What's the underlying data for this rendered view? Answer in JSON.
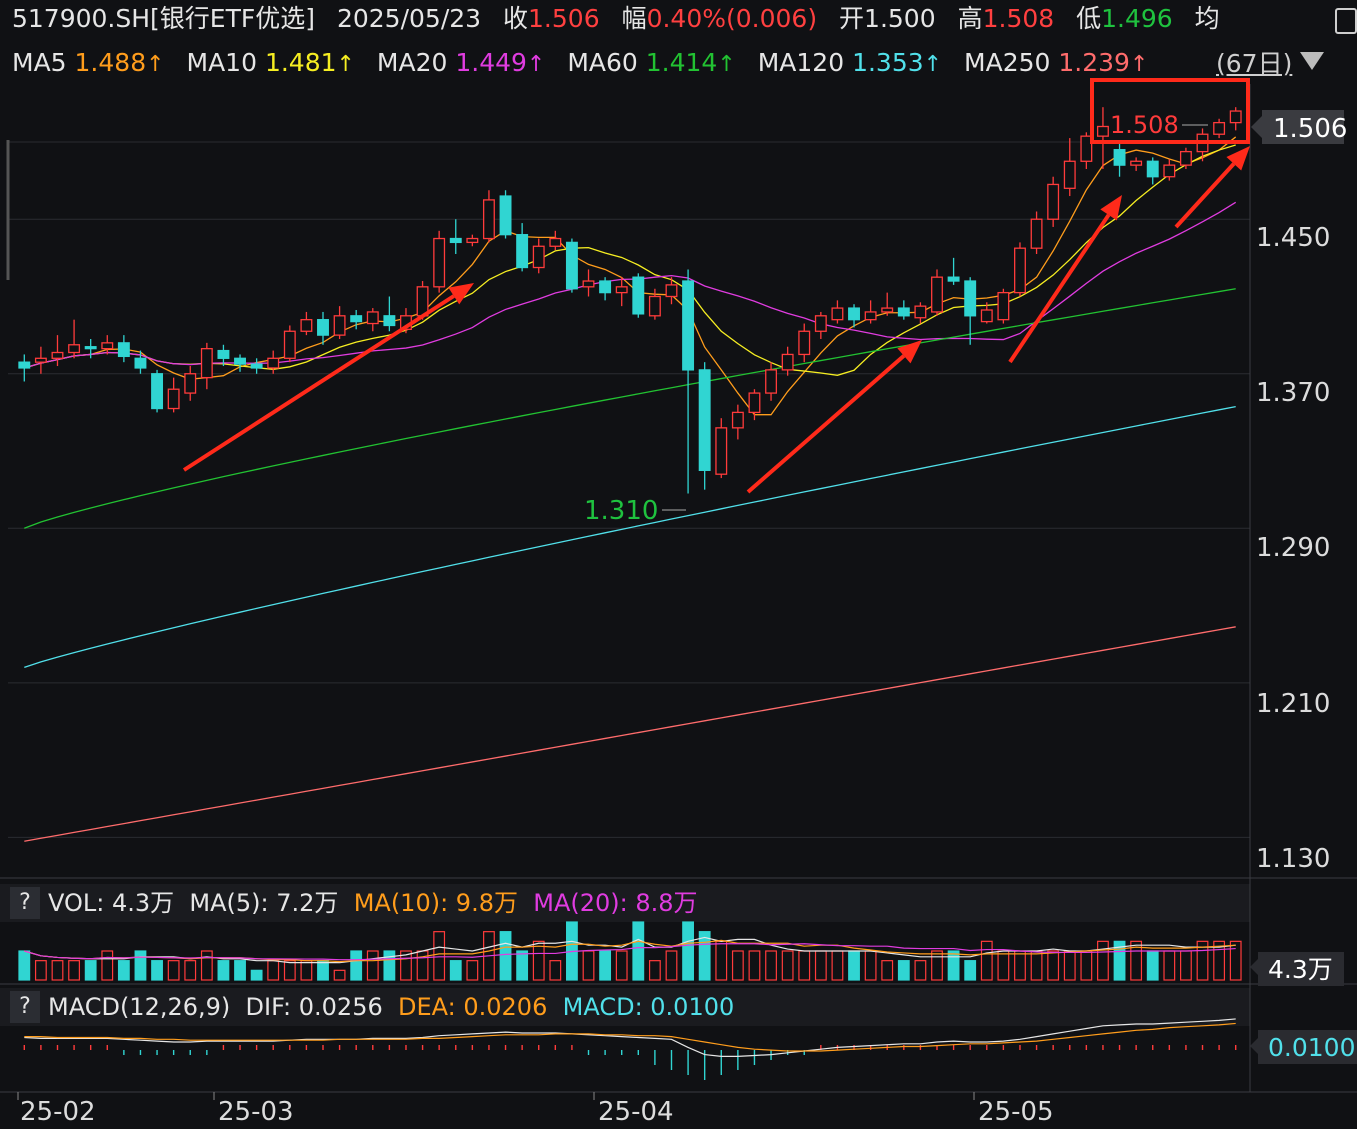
{
  "header": {
    "symbol": "517900.SH[银行ETF优选]",
    "date": "2025/05/23",
    "close_label": "收",
    "close_value": "1.506",
    "change_label": "幅",
    "change_value": "0.40%(0.006)",
    "open_label": "开",
    "open_value": "1.500",
    "high_label": "高",
    "high_value": "1.508",
    "low_label": "低",
    "low_value": "1.496",
    "avg_label": "均"
  },
  "ma_row": {
    "items": [
      {
        "label": "MA5",
        "value": "1.488",
        "arrow": "↑",
        "color": "#ff9d1c"
      },
      {
        "label": "MA10",
        "value": "1.481",
        "arrow": "↑",
        "color": "#f6ee22"
      },
      {
        "label": "MA20",
        "value": "1.449",
        "arrow": "↑",
        "color": "#e03ce0"
      },
      {
        "label": "MA60",
        "value": "1.414",
        "arrow": "↑",
        "color": "#22c232"
      },
      {
        "label": "MA120",
        "value": "1.353",
        "arrow": "↑",
        "color": "#51e0ea"
      },
      {
        "label": "MA250",
        "value": "1.239",
        "arrow": "↑",
        "color": "#ff6c6c"
      }
    ],
    "period": "(67日)"
  },
  "price_axis": {
    "ticks": [
      "1.450",
      "1.370",
      "1.290",
      "1.210",
      "1.130"
    ],
    "current_tag": "1.506"
  },
  "annotations": {
    "high_marker": "1.508",
    "low_marker": "1.310"
  },
  "volume_panel": {
    "help": "?",
    "vol_label": "VOL: 4.3万",
    "ma5_label": "MA(5): 7.2万",
    "ma10_label": "MA(10): 9.8万",
    "ma20_label": "MA(20): 8.8万",
    "current_tag": "4.3万"
  },
  "macd_panel": {
    "help": "?",
    "title": "MACD(12,26,9)",
    "dif_label": "DIF: 0.0256",
    "dea_label": "DEA: 0.0206",
    "macd_label": "MACD: 0.0100",
    "current_tag": "0.0100"
  },
  "date_axis": [
    "25-02",
    "25-03",
    "25-04",
    "25-05"
  ],
  "colors": {
    "up": "#ff3b3b",
    "down": "#30d5d2",
    "ma5": "#ff9d1c",
    "ma10": "#f6ee22",
    "ma20": "#e03ce0",
    "ma60": "#22c232",
    "ma120": "#51e0ea",
    "ma250": "#ff6c6c",
    "annotation": "#ff2a1a"
  },
  "chart_data": {
    "type": "candlestick",
    "ylim": [
      1.11,
      1.52
    ],
    "date_labels": [
      "25-02",
      "25-03",
      "25-04",
      "25-05"
    ],
    "candles": [
      [
        1.376,
        1.373,
        1.38,
        1.366
      ],
      [
        1.376,
        1.378,
        1.384,
        1.37
      ],
      [
        1.378,
        1.381,
        1.39,
        1.374
      ],
      [
        1.381,
        1.385,
        1.398,
        1.378
      ],
      [
        1.384,
        1.383,
        1.388,
        1.378
      ],
      [
        1.383,
        1.386,
        1.39,
        1.38
      ],
      [
        1.386,
        1.379,
        1.39,
        1.376
      ],
      [
        1.378,
        1.373,
        1.382,
        1.37
      ],
      [
        1.37,
        1.352,
        1.372,
        1.35
      ],
      [
        1.352,
        1.362,
        1.368,
        1.35
      ],
      [
        1.36,
        1.37,
        1.374,
        1.356
      ],
      [
        1.368,
        1.383,
        1.386,
        1.362
      ],
      [
        1.382,
        1.378,
        1.385,
        1.374
      ],
      [
        1.378,
        1.375,
        1.38,
        1.371
      ],
      [
        1.375,
        1.373,
        1.378,
        1.37
      ],
      [
        1.373,
        1.378,
        1.382,
        1.37
      ],
      [
        1.378,
        1.392,
        1.395,
        1.376
      ],
      [
        1.392,
        1.398,
        1.402,
        1.39
      ],
      [
        1.398,
        1.39,
        1.402,
        1.385
      ],
      [
        1.39,
        1.4,
        1.405,
        1.388
      ],
      [
        1.4,
        1.397,
        1.403,
        1.393
      ],
      [
        1.396,
        1.402,
        1.404,
        1.392
      ],
      [
        1.4,
        1.395,
        1.41,
        1.392
      ],
      [
        1.393,
        1.4,
        1.404,
        1.391
      ],
      [
        1.4,
        1.415,
        1.418,
        1.398
      ],
      [
        1.415,
        1.44,
        1.444,
        1.412
      ],
      [
        1.44,
        1.438,
        1.45,
        1.432
      ],
      [
        1.438,
        1.44,
        1.442,
        1.436
      ],
      [
        1.44,
        1.46,
        1.465,
        1.438
      ],
      [
        1.462,
        1.442,
        1.465,
        1.44
      ],
      [
        1.442,
        1.425,
        1.448,
        1.423
      ],
      [
        1.425,
        1.436,
        1.44,
        1.422
      ],
      [
        1.436,
        1.44,
        1.444,
        1.434
      ],
      [
        1.438,
        1.414,
        1.44,
        1.412
      ],
      [
        1.415,
        1.418,
        1.424,
        1.41
      ],
      [
        1.418,
        1.412,
        1.42,
        1.408
      ],
      [
        1.412,
        1.415,
        1.42,
        1.405
      ],
      [
        1.42,
        1.401,
        1.422,
        1.399
      ],
      [
        1.4,
        1.41,
        1.414,
        1.398
      ],
      [
        1.41,
        1.416,
        1.42,
        1.406
      ],
      [
        1.418,
        1.372,
        1.424,
        1.308
      ],
      [
        1.372,
        1.32,
        1.376,
        1.31
      ],
      [
        1.318,
        1.342,
        1.347,
        1.316
      ],
      [
        1.342,
        1.35,
        1.354,
        1.336
      ],
      [
        1.35,
        1.36,
        1.362,
        1.346
      ],
      [
        1.36,
        1.372,
        1.376,
        1.356
      ],
      [
        1.372,
        1.38,
        1.384,
        1.369
      ],
      [
        1.38,
        1.392,
        1.396,
        1.376
      ],
      [
        1.392,
        1.4,
        1.402,
        1.388
      ],
      [
        1.398,
        1.404,
        1.408,
        1.396
      ],
      [
        1.404,
        1.398,
        1.406,
        1.394
      ],
      [
        1.398,
        1.402,
        1.408,
        1.396
      ],
      [
        1.402,
        1.404,
        1.412,
        1.4
      ],
      [
        1.404,
        1.4,
        1.408,
        1.398
      ],
      [
        1.399,
        1.405,
        1.407,
        1.396
      ],
      [
        1.402,
        1.42,
        1.424,
        1.4
      ],
      [
        1.42,
        1.418,
        1.43,
        1.416
      ],
      [
        1.418,
        1.4,
        1.42,
        1.385
      ],
      [
        1.397,
        1.403,
        1.407,
        1.396
      ],
      [
        1.398,
        1.412,
        1.414,
        1.396
      ],
      [
        1.412,
        1.435,
        1.438,
        1.41
      ],
      [
        1.435,
        1.45,
        1.454,
        1.432
      ],
      [
        1.45,
        1.468,
        1.472,
        1.446
      ],
      [
        1.466,
        1.48,
        1.492,
        1.462
      ],
      [
        1.48,
        1.493,
        1.495,
        1.476
      ],
      [
        1.493,
        1.498,
        1.508,
        1.476
      ],
      [
        1.486,
        1.478,
        1.489,
        1.472
      ],
      [
        1.478,
        1.48,
        1.482,
        1.475
      ],
      [
        1.48,
        1.472,
        1.482,
        1.468
      ],
      [
        1.472,
        1.478,
        1.481,
        1.47
      ],
      [
        1.478,
        1.485,
        1.487,
        1.476
      ],
      [
        1.485,
        1.494,
        1.497,
        1.48
      ],
      [
        1.494,
        1.5,
        1.502,
        1.492
      ],
      [
        1.5,
        1.506,
        1.508,
        1.496
      ]
    ],
    "volume": [
      3,
      2,
      2,
      2,
      2,
      3,
      2,
      3,
      2,
      2,
      2,
      3,
      2,
      2,
      1,
      2,
      2,
      2,
      2,
      1,
      3,
      3,
      3,
      3,
      3,
      5,
      2,
      2,
      5,
      5,
      3,
      4,
      2,
      6,
      3,
      3,
      3,
      6,
      2,
      3,
      6,
      5,
      4,
      3,
      3,
      3,
      3,
      3,
      3,
      3,
      3,
      3,
      2,
      2,
      2,
      3,
      3,
      2,
      4,
      3,
      3,
      3,
      3,
      3,
      3,
      4,
      4,
      4,
      3,
      3,
      3,
      4,
      4,
      4
    ],
    "macd_hist": [
      1,
      1,
      1,
      1,
      1,
      1,
      -1,
      -1,
      -1,
      -1,
      -1,
      -1,
      1,
      1,
      1,
      1,
      1,
      1,
      1,
      1,
      1,
      1,
      1,
      1,
      1,
      1,
      1,
      1,
      1,
      1,
      1,
      1,
      1,
      1,
      -1,
      -1,
      -1,
      -1,
      -3,
      -4,
      -5,
      -6,
      -5,
      -4,
      -3,
      -2,
      -1,
      -1,
      1,
      1,
      1,
      1,
      1,
      1,
      1,
      1,
      1,
      1,
      1,
      1,
      1,
      1,
      1,
      1,
      1,
      1,
      1,
      1,
      1,
      1,
      1,
      1,
      1,
      1
    ],
    "dif": [
      0.005,
      0.004,
      0.004,
      0.004,
      0.004,
      0.004,
      0.003,
      0.002,
      0.001,
      0.0,
      0.0,
      0.001,
      0.001,
      0.001,
      0.001,
      0.001,
      0.002,
      0.003,
      0.003,
      0.003,
      0.003,
      0.004,
      0.004,
      0.004,
      0.005,
      0.007,
      0.008,
      0.009,
      0.01,
      0.011,
      0.01,
      0.01,
      0.01,
      0.009,
      0.008,
      0.007,
      0.006,
      0.005,
      0.004,
      0.003,
      -0.006,
      -0.014,
      -0.016,
      -0.016,
      -0.015,
      -0.014,
      -0.012,
      -0.01,
      -0.008,
      -0.006,
      -0.005,
      -0.004,
      -0.003,
      -0.002,
      -0.002,
      0.0,
      0.001,
      0.0,
      0.0,
      0.001,
      0.003,
      0.006,
      0.009,
      0.012,
      0.015,
      0.018,
      0.019,
      0.02,
      0.02,
      0.021,
      0.022,
      0.023,
      0.024,
      0.0256
    ],
    "dea": [
      0.006,
      0.006,
      0.005,
      0.005,
      0.005,
      0.005,
      0.004,
      0.004,
      0.003,
      0.003,
      0.002,
      0.002,
      0.002,
      0.002,
      0.002,
      0.002,
      0.002,
      0.002,
      0.002,
      0.003,
      0.003,
      0.003,
      0.003,
      0.003,
      0.004,
      0.004,
      0.005,
      0.006,
      0.007,
      0.008,
      0.008,
      0.008,
      0.009,
      0.009,
      0.009,
      0.008,
      0.008,
      0.007,
      0.007,
      0.006,
      0.003,
      0.0,
      -0.003,
      -0.006,
      -0.008,
      -0.009,
      -0.01,
      -0.01,
      -0.01,
      -0.009,
      -0.008,
      -0.007,
      -0.006,
      -0.005,
      -0.005,
      -0.004,
      -0.003,
      -0.002,
      -0.002,
      -0.001,
      0.0,
      0.001,
      0.003,
      0.005,
      0.007,
      0.009,
      0.011,
      0.013,
      0.014,
      0.016,
      0.017,
      0.018,
      0.019,
      0.0206
    ]
  }
}
